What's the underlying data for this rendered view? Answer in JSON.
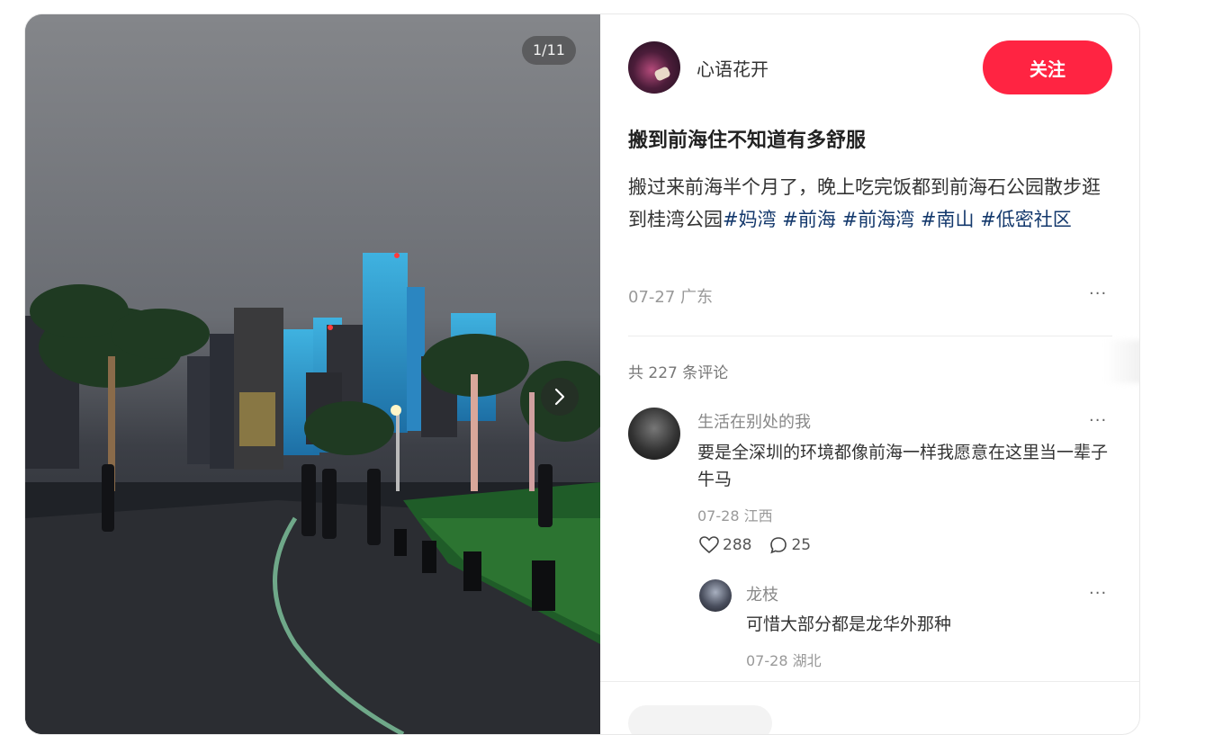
{
  "media": {
    "counter": "1/11",
    "next_icon": "chevron-right-icon"
  },
  "author": {
    "name": "心语花开",
    "follow_label": "关注"
  },
  "note": {
    "title": "搬到前海住不知道有多舒服",
    "description": "搬过来前海半个月了，晚上吃完饭都到前海石公园散步逛到桂湾公园",
    "tags": [
      "#妈湾",
      "#前海",
      "#前海湾",
      "#南山",
      "#低密社区"
    ],
    "date": "07-27",
    "location": "广东",
    "more": "···"
  },
  "comments": {
    "total_label": "共 227 条评论",
    "items": [
      {
        "user": "生活在别处的我",
        "text": "要是全深圳的环境都像前海一样我愿意在这里当一辈子牛马",
        "date": "07-28",
        "location": "江西",
        "likes": "288",
        "replies": "25",
        "more": "···"
      }
    ],
    "reply": {
      "user": "龙枝",
      "text": "可惜大部分都是龙华外那种",
      "date": "07-28",
      "location": "湖北",
      "more": "···"
    }
  },
  "colors": {
    "accent": "#ff2442",
    "tag": "#13386c"
  }
}
